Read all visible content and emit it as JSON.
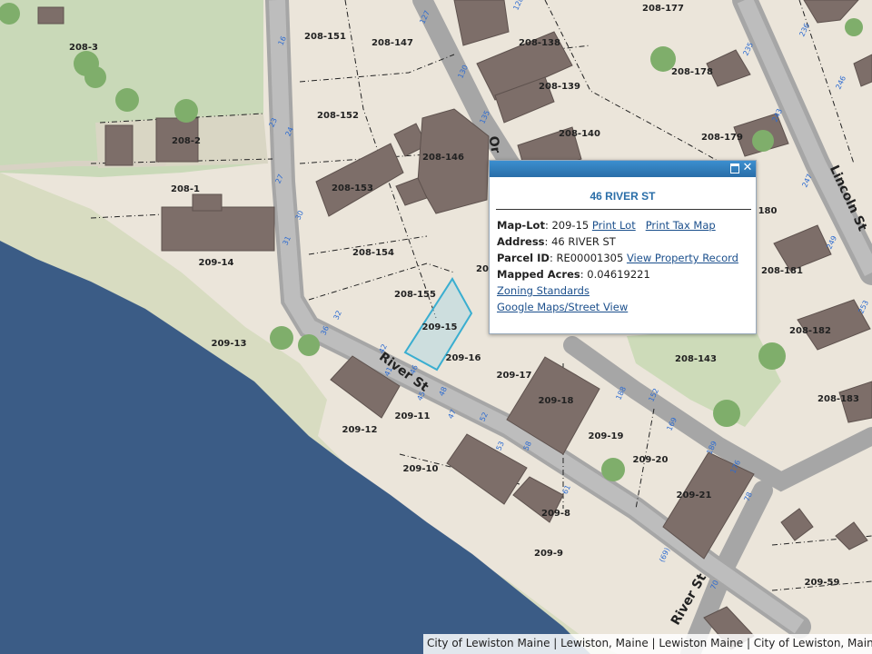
{
  "colors": {
    "water": "#3b5c86",
    "ground": "#ebe5da",
    "park": "#c8d8b6",
    "road": "#a8a8a8",
    "building": "#7d6e69",
    "tree": "#7fae6b",
    "selected_outline": "#3aaed0",
    "popup_header": "#2a6ea8",
    "link": "#1b4f8c"
  },
  "map": {
    "lots": [
      "208-3",
      "208-151",
      "208-147",
      "208-177",
      "208-138",
      "208-139",
      "208-178",
      "208-152",
      "208-140",
      "208-179",
      "208-2",
      "208-146",
      "208-153",
      "208-1",
      "180",
      "208-154",
      "209-14",
      "208-181",
      "208-155",
      "209-15",
      "209-13",
      "209-16",
      "209-17",
      "208-182",
      "208-143",
      "209-18",
      "208-183",
      "209-11",
      "209-12",
      "209-19",
      "209-20",
      "209-10",
      "209-21",
      "209-8",
      "209-9",
      "209-59",
      "20"
    ],
    "streets": [
      "River St",
      "River St",
      "Lincoln St",
      "Or"
    ],
    "address_numbers": [
      "16",
      "23",
      "24",
      "27",
      "30",
      "31",
      "32",
      "36",
      "42",
      "41",
      "46",
      "45",
      "48",
      "47",
      "52",
      "53",
      "58",
      "61",
      "(69)",
      "70",
      "78",
      "127",
      "128",
      "130",
      "135",
      "236",
      "235",
      "246",
      "243",
      "247",
      "249",
      "253",
      "188",
      "152",
      "169",
      "189",
      "176"
    ]
  },
  "popup": {
    "title": "46 RIVER ST",
    "maplot_label": "Map-Lot",
    "maplot_value": "209-15",
    "print_lot_link": "Print Lot",
    "print_tax_map_link": "Print Tax Map",
    "address_label": "Address",
    "address_value": "46 RIVER ST",
    "parcel_label": "Parcel ID",
    "parcel_value": "RE00001305",
    "view_record_link": "View Property Record",
    "acres_label": "Mapped Acres",
    "acres_value": "0.04619221",
    "zoning_link": "Zoning Standards",
    "google_link": "Google Maps/Street View",
    "maximize_icon": "maximize-icon",
    "close_icon": "close-icon"
  },
  "attribution": "City of Lewiston Maine | Lewiston, Maine | Lewiston Maine | City of Lewiston, Maine, Esri, HERE"
}
